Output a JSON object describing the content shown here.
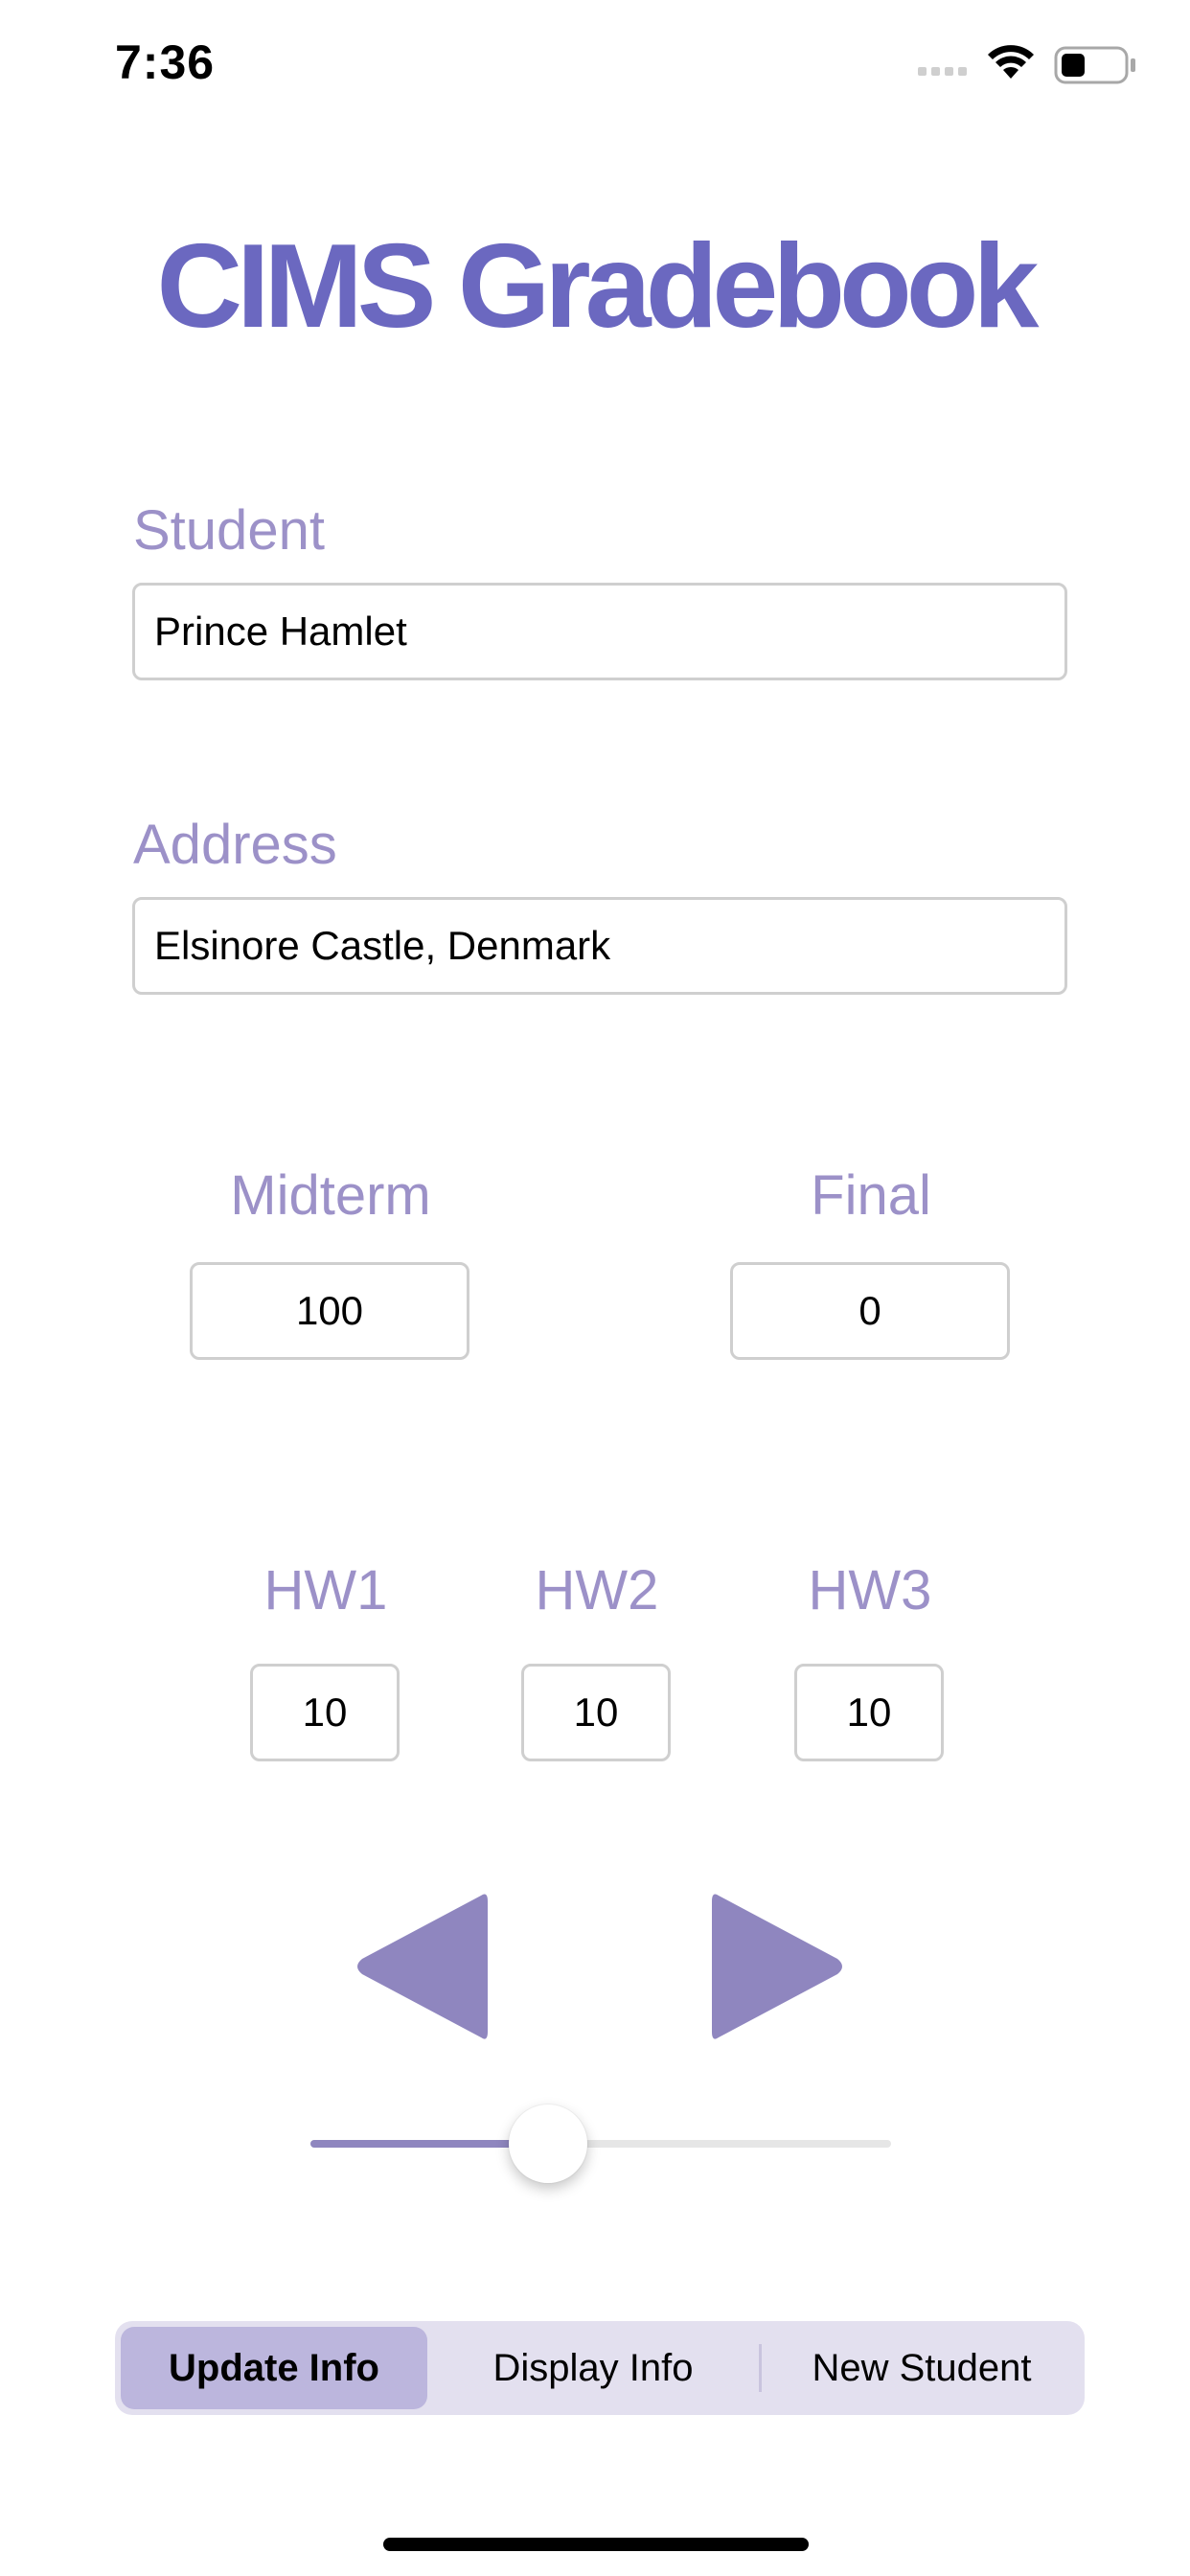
{
  "status_bar": {
    "time": "7:36"
  },
  "app": {
    "title": "CIMS Gradebook",
    "accent_color": "#6b68c0",
    "label_color": "#9c91c8",
    "control_color": "#8f86bf"
  },
  "form": {
    "student": {
      "label": "Student",
      "value": "Prince Hamlet"
    },
    "address": {
      "label": "Address",
      "value": "Elsinore Castle, Denmark"
    },
    "midterm": {
      "label": "Midterm",
      "value": "100"
    },
    "final": {
      "label": "Final",
      "value": "0"
    },
    "hw1": {
      "label": "HW1",
      "value": "10"
    },
    "hw2": {
      "label": "HW2",
      "value": "10"
    },
    "hw3": {
      "label": "HW3",
      "value": "10"
    }
  },
  "navigation": {
    "prev_icon": "triangle-left-icon",
    "next_icon": "triangle-right-icon"
  },
  "slider": {
    "value_fraction": 0.41
  },
  "segmented": {
    "items": [
      {
        "label": "Update Info",
        "selected": true
      },
      {
        "label": "Display Info",
        "selected": false
      },
      {
        "label": "New Student",
        "selected": false
      }
    ]
  }
}
